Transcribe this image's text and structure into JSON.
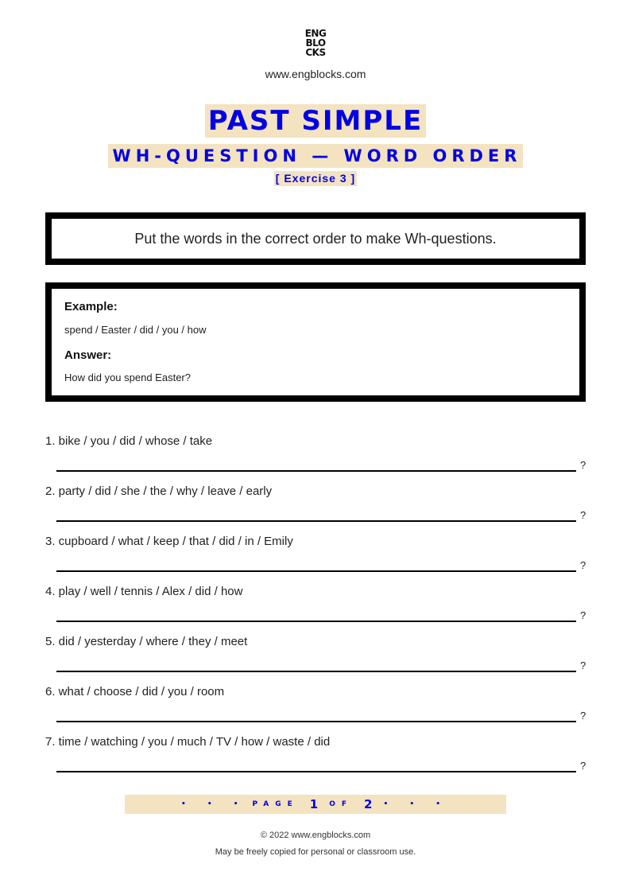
{
  "header": {
    "logo_lines": [
      "ENG",
      "BLO",
      "CKS"
    ],
    "site_url": "www.engblocks.com",
    "title": "PAST SIMPLE",
    "subtitle": "WH-QUESTION — WORD ORDER",
    "exercise_label": "[ Exercise 3 ]"
  },
  "instructions": "Put the words in the correct order to make Wh-questions.",
  "example": {
    "example_label": "Example:",
    "example_words": "spend / Easter / did / you / how",
    "answer_label": "Answer:",
    "answer_text": "How did you spend Easter?"
  },
  "questions": [
    {
      "text": "1. bike / you / did / whose / take",
      "suffix": "?"
    },
    {
      "text": "2. party / did / she / the / why / leave / early",
      "suffix": "?"
    },
    {
      "text": "3. cupboard / what / keep / that / did / in / Emily",
      "suffix": "?"
    },
    {
      "text": "4. play / well / tennis / Alex / did / how",
      "suffix": "?"
    },
    {
      "text": "5. did / yesterday / where / they / meet",
      "suffix": "?"
    },
    {
      "text": "6. what / choose / did / you / room",
      "suffix": "?"
    },
    {
      "text": "7. time / watching / you / much / TV / how / waste / did",
      "suffix": "?"
    }
  ],
  "pagination": {
    "dots_left": "• • •",
    "page_word": "PAGE",
    "current": "1",
    "of_word": "OF",
    "total": "2",
    "dots_right": "• • •"
  },
  "footer": {
    "copyright": "© 2022 www.engblocks.com",
    "license": "May be freely copied for personal or classroom use."
  },
  "colors": {
    "accent_blue": "#0000e6",
    "highlight_beige": "#f4e3c1",
    "border_black": "#000000"
  }
}
